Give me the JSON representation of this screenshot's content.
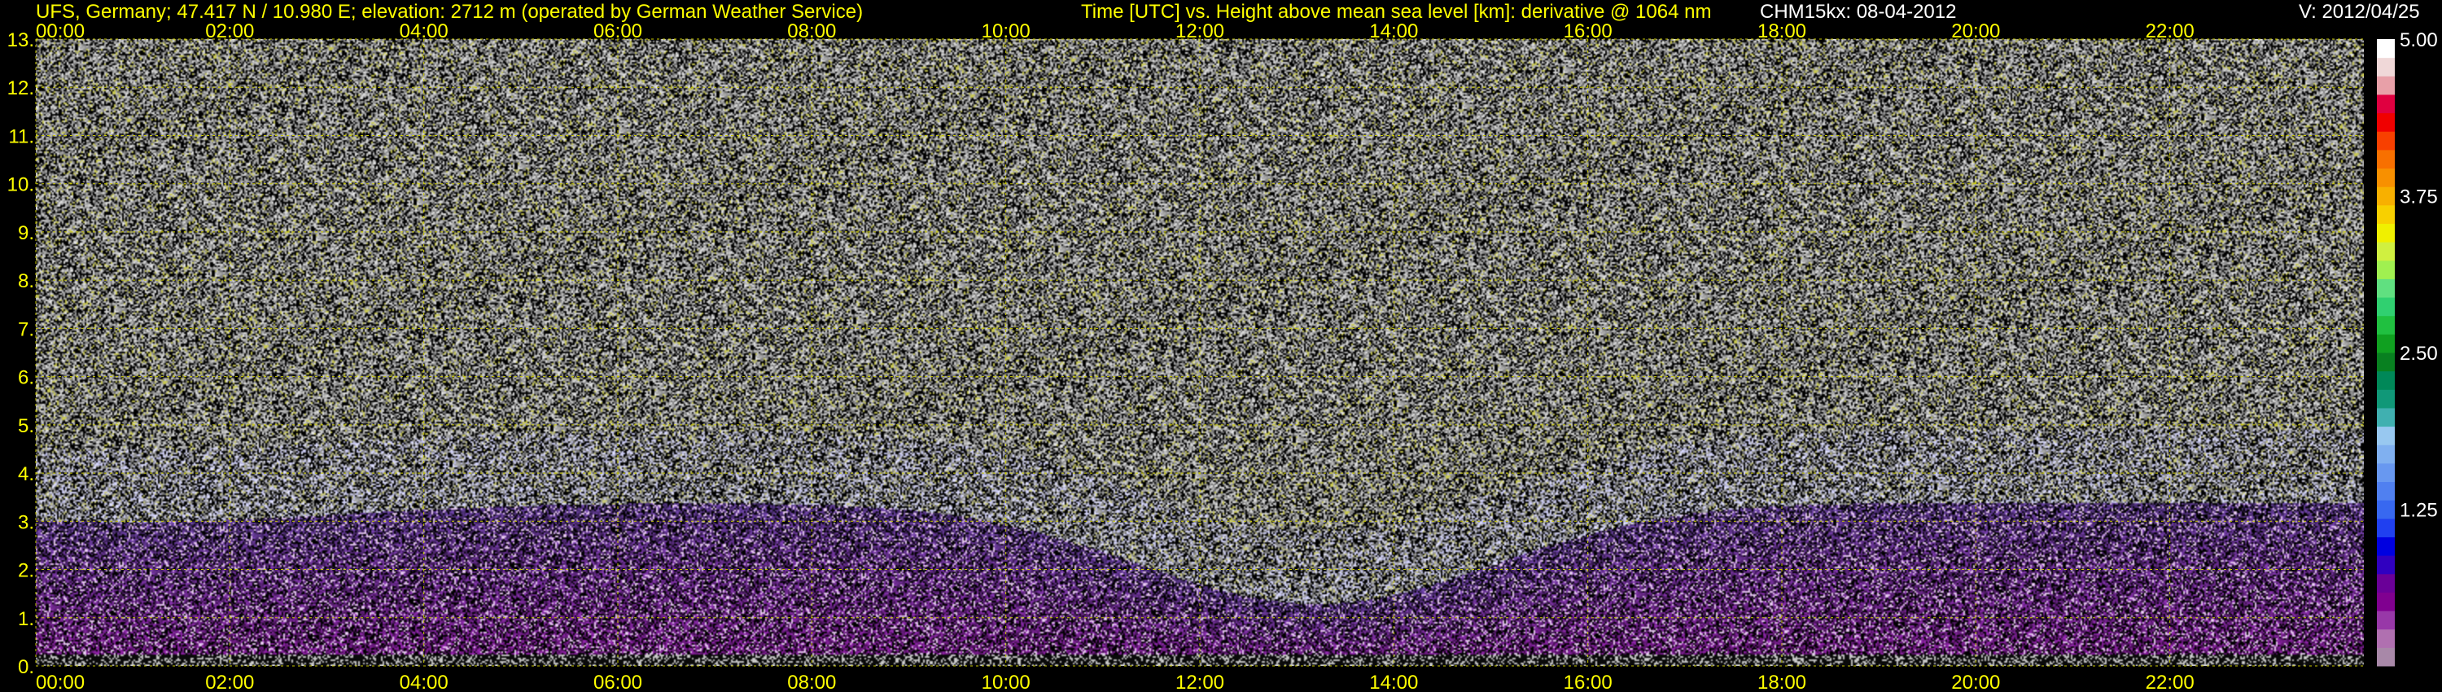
{
  "header": {
    "station": "UFS, Germany; 47.417 N / 10.980 E; elevation: 2712 m  (operated by German Weather Service)",
    "description": "Time [UTC] vs. Height above mean sea level [km]: derivative @ 1064 nm",
    "instrument": "CHM15kx: 08-04-2012",
    "version": "V: 2012/04/25"
  },
  "colors": {
    "axis_text": "#ffff00",
    "grid": "#c8c800",
    "background": "#000000",
    "header_white": "#ffffff"
  },
  "chart_data": {
    "type": "heatmap",
    "title": "Time [UTC] vs. Height above mean sea level [km]: derivative @ 1064 nm",
    "xlabel": "",
    "ylabel": "",
    "xlim": [
      0,
      24
    ],
    "ylim": [
      0,
      13
    ],
    "x_ticks": [
      "00:00",
      "02:00",
      "04:00",
      "06:00",
      "08:00",
      "10:00",
      "12:00",
      "14:00",
      "16:00",
      "18:00",
      "20:00",
      "22:00"
    ],
    "x_tick_hours": [
      0,
      2,
      4,
      6,
      8,
      10,
      12,
      14,
      16,
      18,
      20,
      22
    ],
    "y_ticks": [
      "0.",
      "1.",
      "2.",
      "3.",
      "4.",
      "5.",
      "6.",
      "7.",
      "8.",
      "9.",
      "10.",
      "11.",
      "12.",
      "13."
    ],
    "y_tick_values": [
      0,
      1,
      2,
      3,
      4,
      5,
      6,
      7,
      8,
      9,
      10,
      11,
      12,
      13
    ],
    "grid": true,
    "colorbar": {
      "placement": "right",
      "range": [
        0,
        5
      ],
      "tick_labels": [
        "5.00",
        "3.75",
        "2.50",
        "1.25"
      ],
      "tick_values": [
        5.0,
        3.75,
        2.5,
        1.25
      ],
      "colors": [
        "#a888a8",
        "#b070b0",
        "#9838a8",
        "#800090",
        "#6a0098",
        "#3000c0",
        "#0000e0",
        "#2040f0",
        "#3868f0",
        "#5080f0",
        "#6898f0",
        "#80b0f0",
        "#98c8f0",
        "#40b0b0",
        "#109878",
        "#008858",
        "#088020",
        "#10a020",
        "#20c040",
        "#30d070",
        "#60e080",
        "#a0f050",
        "#d0f040",
        "#f0f000",
        "#f8d000",
        "#f8b000",
        "#f89000",
        "#f87000",
        "#f84000",
        "#f00000",
        "#e00040",
        "#e8a0a8",
        "#f0d8d8",
        "#ffffff"
      ]
    }
  }
}
